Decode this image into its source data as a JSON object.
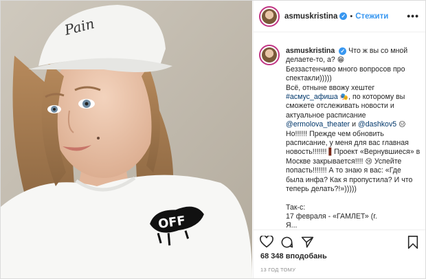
{
  "header": {
    "username": "asmuskristina",
    "verified_mark": "✓",
    "separator": "•",
    "follow_label": "Стежити",
    "more_label": "•••"
  },
  "photo": {
    "cap_text": "Pain",
    "shirt_logo": "OFF"
  },
  "caption": {
    "username": "asmuskristina",
    "line1": "Что ж вы со мной делаете-то, а?",
    "emoji1": "😁",
    "line2": "Беззастенчиво много вопросов про спектакли)))))",
    "line3a": "Всё, отныне ввожу хештег",
    "hashtag": "#асмус_афиша",
    "emoji2": "🎭",
    "line3b": ", по которому вы сможете отслеживать новости и актуальное расписание",
    "mention1": "@ermolova_theater",
    "and": "и",
    "mention2": "@dashkov5",
    "emoji3": "😑",
    "line4": "Но!!!!!! Прежде чем обновить расписание, у меня для вас главная новость!!!!!!!",
    "emoji4": "▌",
    "line4b": "Проект «Вернувшиеся» в Москве закрывается!!!!",
    "emoji5": "😢",
    "line4c": "Успейте попасть!!!!!!! А то знаю я вас: «Где была инфа? Как я пропустила? И что теперь делать?!»)))))",
    "line5": "Так-с:",
    "line6": "17 февраля - «ГАМЛЕТ» (г.",
    "line7": "Я..."
  },
  "footer": {
    "likes": "68 348 вподобань",
    "time": "13 ГОД ТОМУ"
  },
  "icons": [
    "heart-icon",
    "comment-icon",
    "share-icon",
    "bookmark-icon",
    "more-icon",
    "verified-icon"
  ],
  "colors": {
    "accent": "#3897f0",
    "link": "#00376b",
    "border": "#dbdbdb",
    "muted": "#8e8e8e"
  }
}
